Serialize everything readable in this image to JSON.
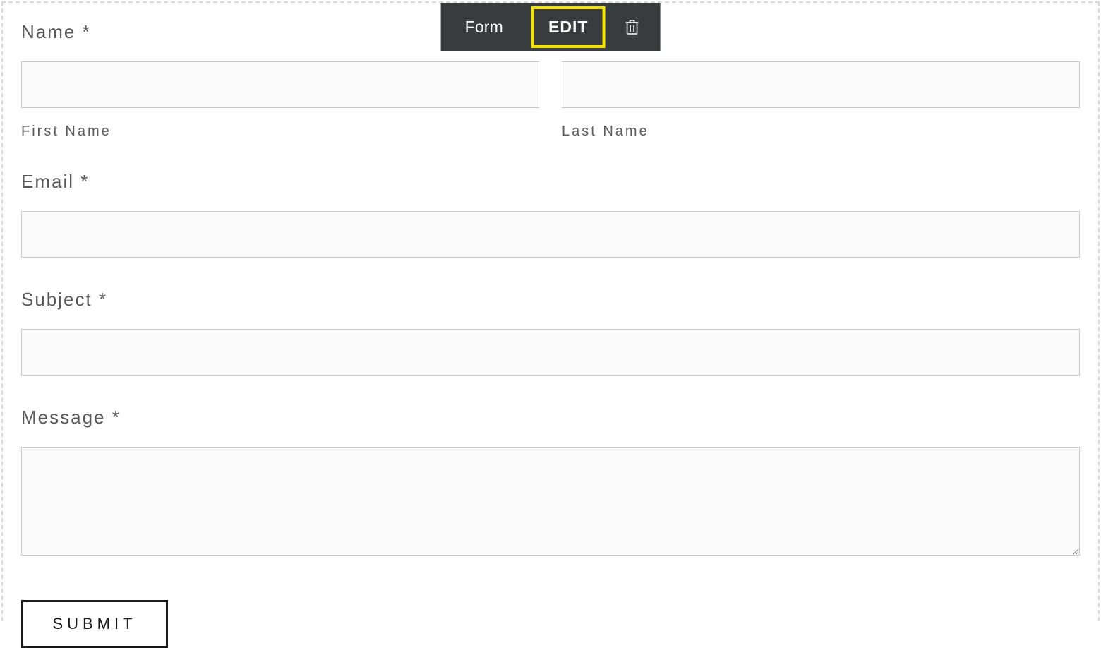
{
  "toolbar": {
    "label": "Form",
    "edit": "EDIT",
    "trash_icon": "trash-icon"
  },
  "form": {
    "name": {
      "label": "Name *",
      "first_sublabel": "First Name",
      "last_sublabel": "Last Name",
      "first_value": "",
      "last_value": ""
    },
    "email": {
      "label": "Email *",
      "value": ""
    },
    "subject": {
      "label": "Subject *",
      "value": ""
    },
    "message": {
      "label": "Message *",
      "value": ""
    },
    "submit_label": "SUBMIT"
  }
}
